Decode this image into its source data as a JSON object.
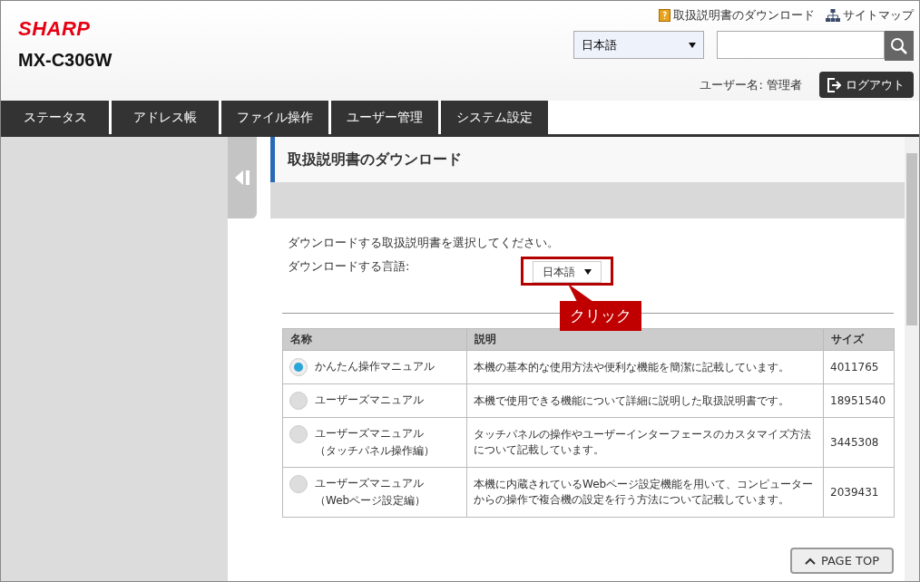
{
  "header": {
    "logo": "SHARP",
    "model": "MX-C306W",
    "links": [
      {
        "kind": "manual",
        "label": "取扱説明書のダウンロード"
      },
      {
        "kind": "sitemap",
        "label": "サイトマップ"
      }
    ],
    "language": "日本語",
    "user_label": "ユーザー名: 管理者",
    "logout": "ログアウト"
  },
  "tabs": [
    {
      "label": "ステータス",
      "selected": false
    },
    {
      "label": "アドレス帳",
      "selected": false
    },
    {
      "label": "ファイル操作",
      "selected": false
    },
    {
      "label": "ユーザー管理",
      "selected": false
    },
    {
      "label": "システム設定",
      "selected": false
    }
  ],
  "page": {
    "title": "取扱説明書のダウンロード",
    "instruction": "ダウンロードする取扱説明書を選択してください。",
    "language_label": "ダウンロードする言語:",
    "language": "日本語",
    "callout": "クリック"
  },
  "table": {
    "columns": [
      "名称",
      "説明",
      "サイズ"
    ],
    "rows": [
      {
        "name": "かんたん操作マニュアル",
        "description": "本機の基本的な使用方法や便利な機能を簡潔に記載しています。",
        "size": "4011765",
        "selected": true
      },
      {
        "name": "ユーザーズマニュアル",
        "description": "本機で使用できる機能について詳細に説明した取扱説明書です。",
        "size": "18951540",
        "selected": false
      },
      {
        "name": "ユーザーズマニュアル（タッチパネル操作編）",
        "description": "タッチパネルの操作やユーザーインターフェースのカスタマイズ方法について記載しています。",
        "size": "3445308",
        "selected": false
      },
      {
        "name": "ユーザーズマニュアル（Webページ設定編）",
        "description": "本機に内蔵されているWebページ設定機能を用いて、コンピューターからの操作で複合機の設定を行う方法について記載しています。",
        "size": "2039431",
        "selected": false
      }
    ]
  },
  "page_top": "PAGE TOP"
}
